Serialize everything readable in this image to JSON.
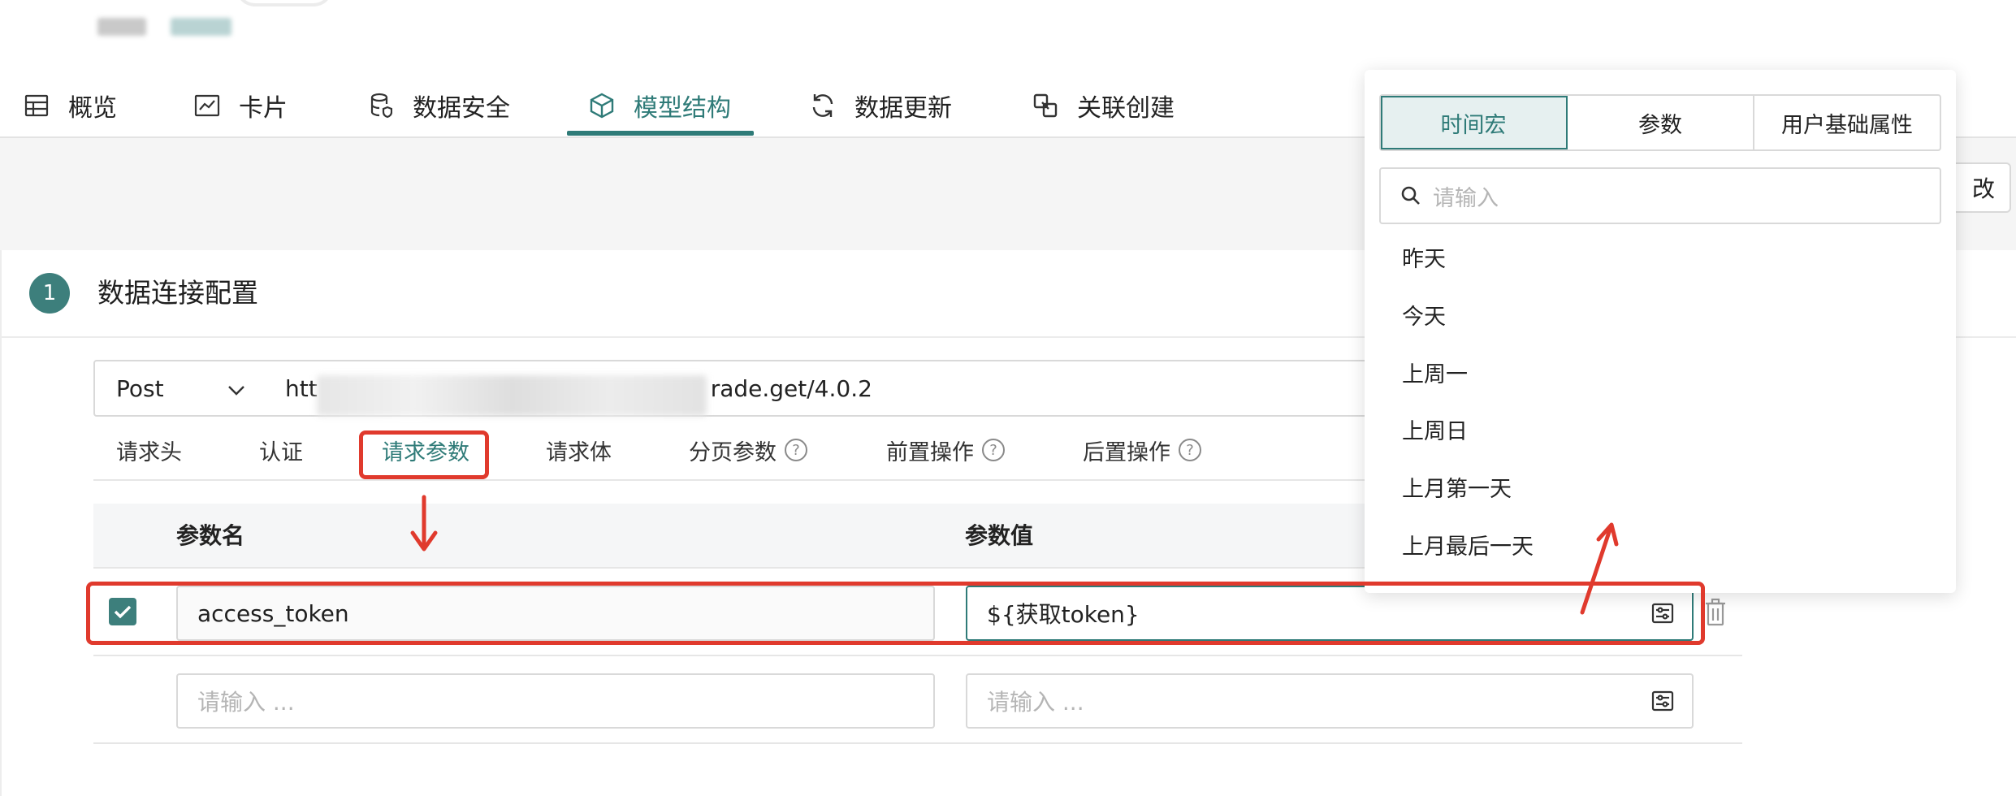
{
  "tabs": [
    {
      "label": "概览",
      "icon": "table-icon"
    },
    {
      "label": "卡片",
      "icon": "chart-icon"
    },
    {
      "label": "数据安全",
      "icon": "database-icon"
    },
    {
      "label": "模型结构",
      "icon": "cube-icon",
      "active": true
    },
    {
      "label": "数据更新",
      "icon": "refresh-icon"
    },
    {
      "label": "关联创建",
      "icon": "link-icon"
    }
  ],
  "toolbar": {
    "edit_label": "改"
  },
  "section": {
    "step": "1",
    "title": "数据连接配置"
  },
  "request": {
    "method": "Post",
    "url_prefix": "htt",
    "url_suffix": "rade.get/4.0.2"
  },
  "subtabs": [
    {
      "label": "请求头"
    },
    {
      "label": "认证"
    },
    {
      "label": "请求参数",
      "active": true
    },
    {
      "label": "请求体"
    },
    {
      "label": "分页参数",
      "help": "?"
    },
    {
      "label": "前置操作",
      "help": "?"
    },
    {
      "label": "后置操作",
      "help": "?"
    }
  ],
  "table": {
    "col_name": "参数名",
    "col_value": "参数值",
    "rows": [
      {
        "checked": true,
        "name": "access_token",
        "value": "${获取token}"
      },
      {
        "checked": false,
        "name_placeholder": "请输入 ...",
        "value_placeholder": "请输入 ..."
      }
    ]
  },
  "popup": {
    "segments": [
      {
        "label": "时间宏",
        "active": true
      },
      {
        "label": "参数"
      },
      {
        "label": "用户基础属性"
      }
    ],
    "search_placeholder": "请输入",
    "options": [
      "昨天",
      "今天",
      "上周一",
      "上周日",
      "上月第一天",
      "上月最后一天"
    ]
  },
  "colors": {
    "accent": "#2f7b78",
    "annotation": "#e03a2d"
  }
}
